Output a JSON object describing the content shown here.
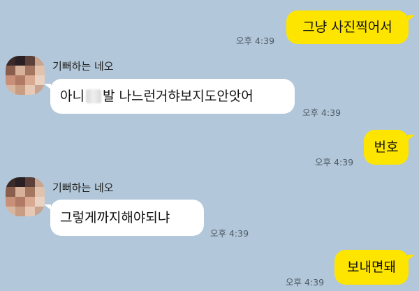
{
  "chat": {
    "messages": [
      {
        "sender": "me",
        "text": "그냥 사진찍어서",
        "time": "오후 4:39"
      },
      {
        "sender": "기뻐하는 네오",
        "text_before": "아니",
        "text_after": "발 나느런거햐보지도안앗어",
        "time": "오후 4:39"
      },
      {
        "sender": "me",
        "text": "번호",
        "time": "오후 4:39"
      },
      {
        "sender": "기뻐하는 네오",
        "text": "그렇게까지해야되냐",
        "time": "오후 4:39"
      },
      {
        "sender": "me",
        "text": "보내면돼",
        "time": "오후 4:39"
      }
    ]
  },
  "colors": {
    "background": "#b2c7d9",
    "my_bubble": "#fee500",
    "their_bubble": "#ffffff"
  },
  "icons": {
    "avatar": "pixelated-profile-photo",
    "censor": "blurred-character"
  }
}
